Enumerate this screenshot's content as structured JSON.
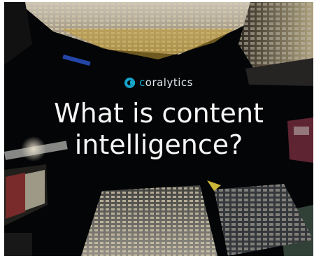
{
  "brand": {
    "prefix": "c",
    "name": "oralytics",
    "accent_color": "#16a4c9",
    "icon": "coralytics-logo-icon"
  },
  "headline": {
    "line1": "What is content",
    "line2": "intelligence?"
  },
  "colors": {
    "background": "#050608",
    "text": "#f5f5f5"
  }
}
